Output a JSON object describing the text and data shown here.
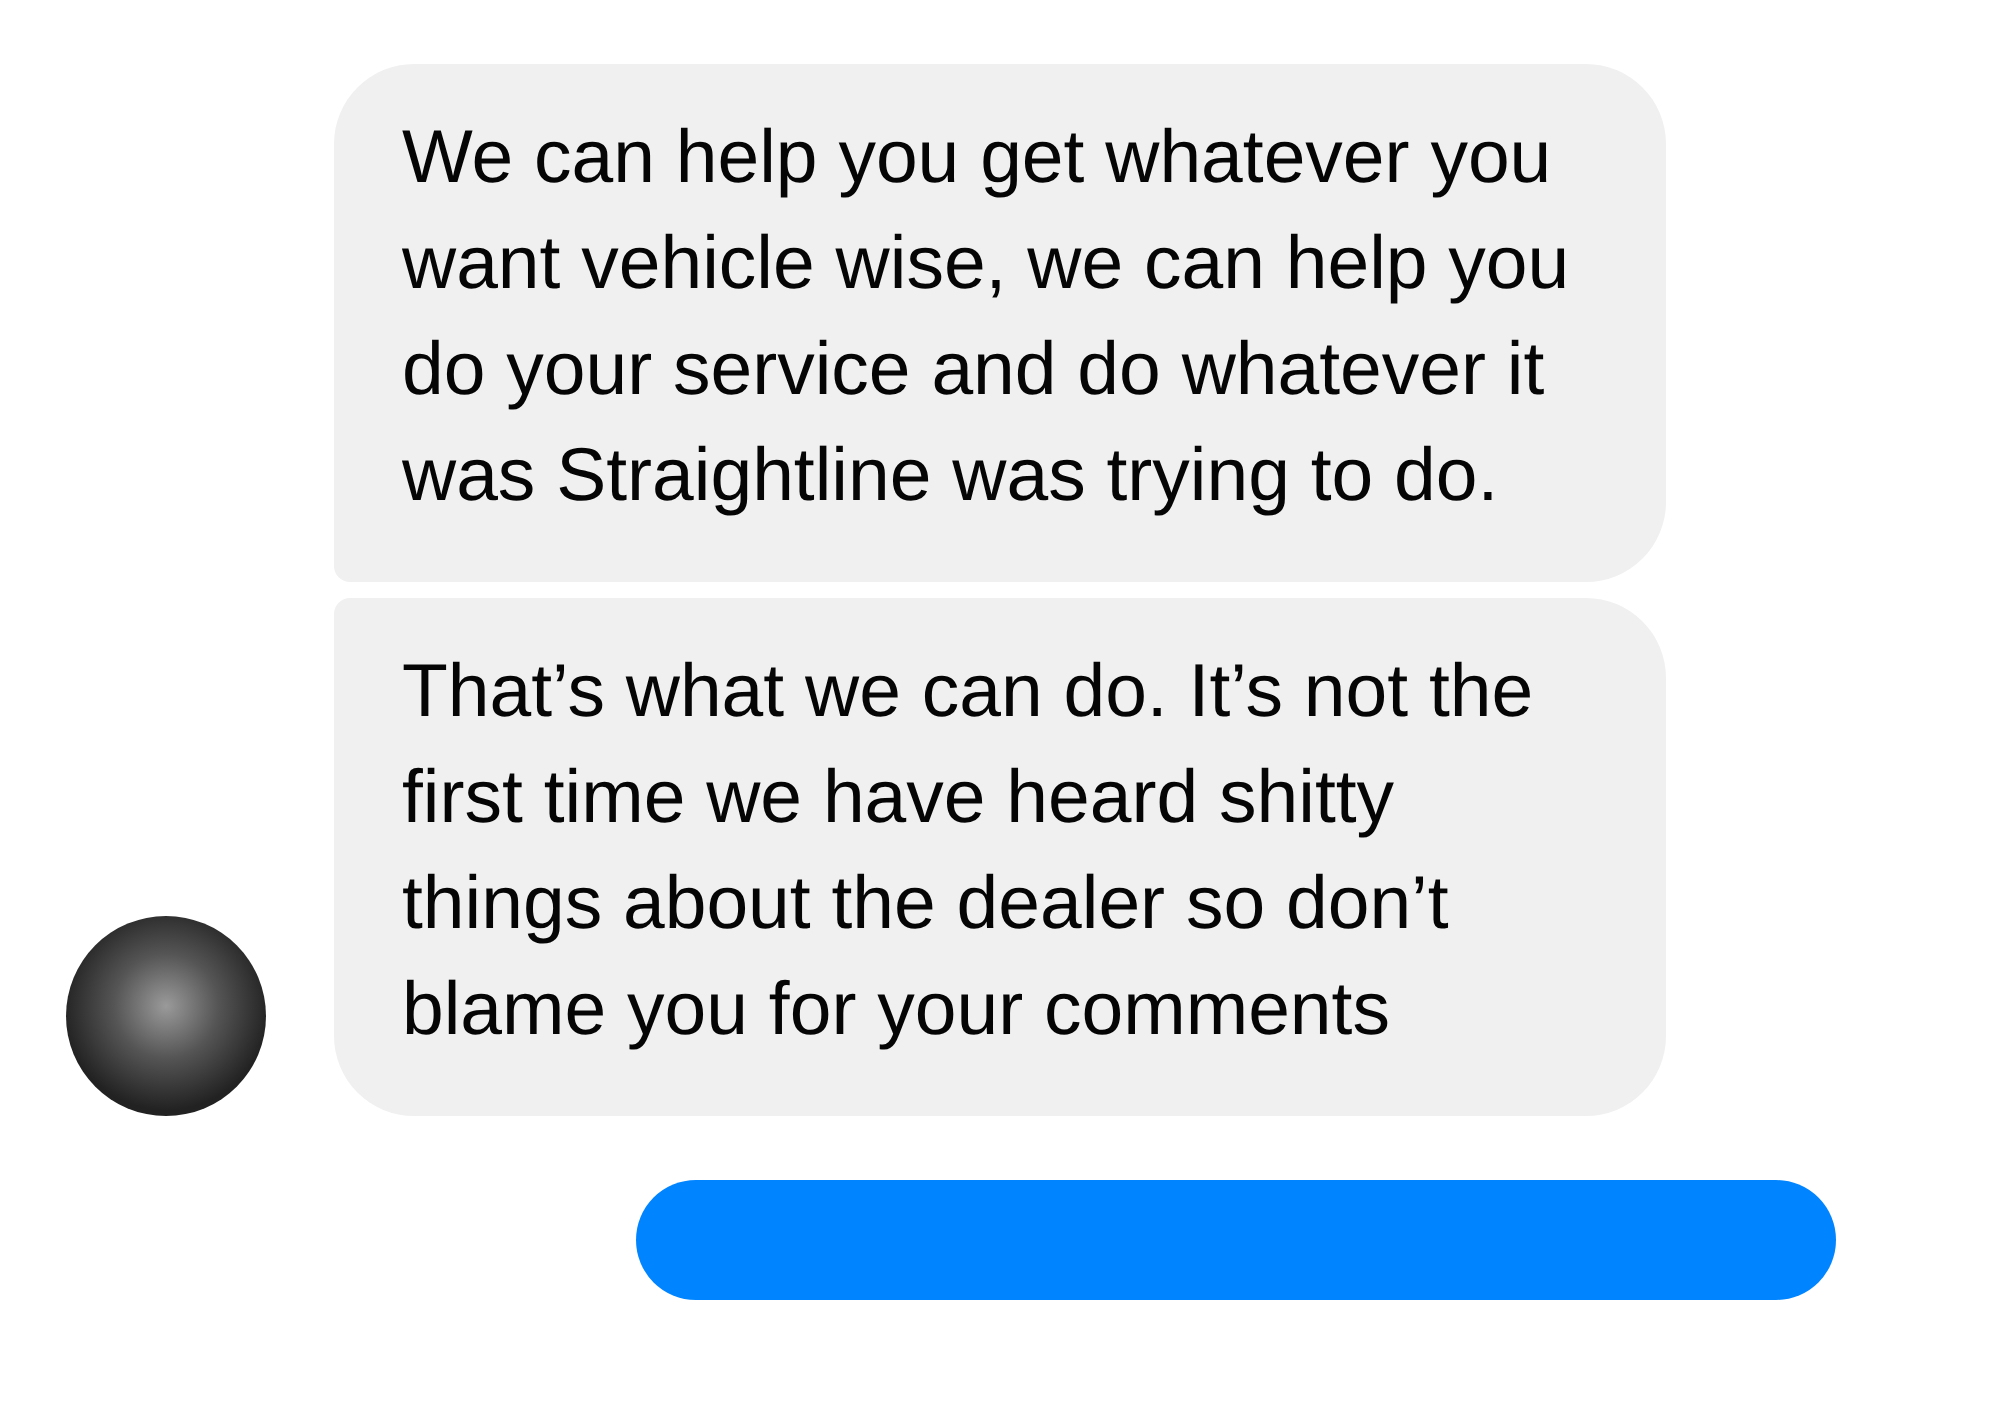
{
  "messages": [
    {
      "kind": "incoming",
      "text": "We can help you get whatever you want vehicle wise, we can help you do your service and do whatever it was Straightline was trying to do."
    },
    {
      "kind": "incoming",
      "text": "That’s what we can do. It’s not the first time we have heard shitty things about the dealer so don’t blame you for your comments"
    },
    {
      "kind": "outgoing"
    }
  ]
}
